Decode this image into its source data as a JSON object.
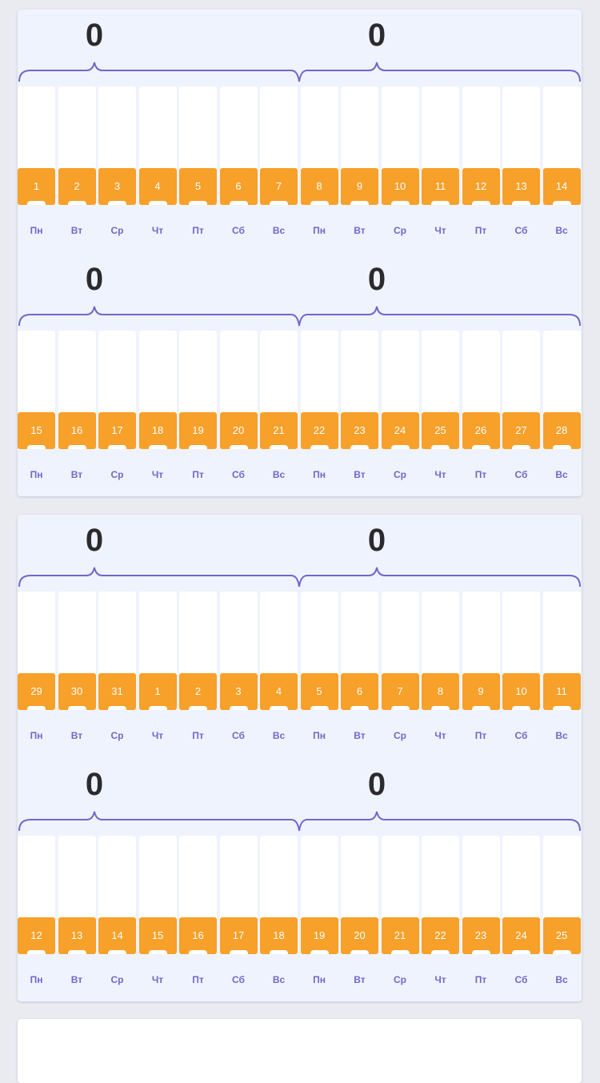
{
  "accent_color": "#f7a02a",
  "weekday_color": "#7366c9",
  "cards": [
    {
      "blocks": [
        {
          "totals": [
            "0",
            "0"
          ],
          "days": [
            {
              "num": "1",
              "wd": "Пн"
            },
            {
              "num": "2",
              "wd": "Вт"
            },
            {
              "num": "3",
              "wd": "Ср"
            },
            {
              "num": "4",
              "wd": "Чт"
            },
            {
              "num": "5",
              "wd": "Пт"
            },
            {
              "num": "6",
              "wd": "Сб"
            },
            {
              "num": "7",
              "wd": "Вс"
            },
            {
              "num": "8",
              "wd": "Пн"
            },
            {
              "num": "9",
              "wd": "Вт"
            },
            {
              "num": "10",
              "wd": "Ср"
            },
            {
              "num": "11",
              "wd": "Чт"
            },
            {
              "num": "12",
              "wd": "Пт"
            },
            {
              "num": "13",
              "wd": "Сб"
            },
            {
              "num": "14",
              "wd": "Вс"
            }
          ]
        },
        {
          "totals": [
            "0",
            "0"
          ],
          "days": [
            {
              "num": "15",
              "wd": "Пн"
            },
            {
              "num": "16",
              "wd": "Вт"
            },
            {
              "num": "17",
              "wd": "Ср"
            },
            {
              "num": "18",
              "wd": "Чт"
            },
            {
              "num": "19",
              "wd": "Пт"
            },
            {
              "num": "20",
              "wd": "Сб"
            },
            {
              "num": "21",
              "wd": "Вс"
            },
            {
              "num": "22",
              "wd": "Пн"
            },
            {
              "num": "23",
              "wd": "Вт"
            },
            {
              "num": "24",
              "wd": "Ср"
            },
            {
              "num": "25",
              "wd": "Чт"
            },
            {
              "num": "26",
              "wd": "Пт"
            },
            {
              "num": "27",
              "wd": "Сб"
            },
            {
              "num": "28",
              "wd": "Вс"
            }
          ]
        }
      ]
    },
    {
      "blocks": [
        {
          "totals": [
            "0",
            "0"
          ],
          "days": [
            {
              "num": "29",
              "wd": "Пн"
            },
            {
              "num": "30",
              "wd": "Вт"
            },
            {
              "num": "31",
              "wd": "Ср"
            },
            {
              "num": "1",
              "wd": "Чт"
            },
            {
              "num": "2",
              "wd": "Пт"
            },
            {
              "num": "3",
              "wd": "Сб"
            },
            {
              "num": "4",
              "wd": "Вс"
            },
            {
              "num": "5",
              "wd": "Пн"
            },
            {
              "num": "6",
              "wd": "Вт"
            },
            {
              "num": "7",
              "wd": "Ср"
            },
            {
              "num": "8",
              "wd": "Чт"
            },
            {
              "num": "9",
              "wd": "Пт"
            },
            {
              "num": "10",
              "wd": "Сб"
            },
            {
              "num": "11",
              "wd": "Вс"
            }
          ]
        },
        {
          "totals": [
            "0",
            "0"
          ],
          "days": [
            {
              "num": "12",
              "wd": "Пн"
            },
            {
              "num": "13",
              "wd": "Вт"
            },
            {
              "num": "14",
              "wd": "Ср"
            },
            {
              "num": "15",
              "wd": "Чт"
            },
            {
              "num": "16",
              "wd": "Пт"
            },
            {
              "num": "17",
              "wd": "Сб"
            },
            {
              "num": "18",
              "wd": "Вс"
            },
            {
              "num": "19",
              "wd": "Пн"
            },
            {
              "num": "20",
              "wd": "Вт"
            },
            {
              "num": "21",
              "wd": "Ср"
            },
            {
              "num": "22",
              "wd": "Чт"
            },
            {
              "num": "23",
              "wd": "Пт"
            },
            {
              "num": "24",
              "wd": "Сб"
            },
            {
              "num": "25",
              "wd": "Вс"
            }
          ]
        }
      ]
    }
  ]
}
